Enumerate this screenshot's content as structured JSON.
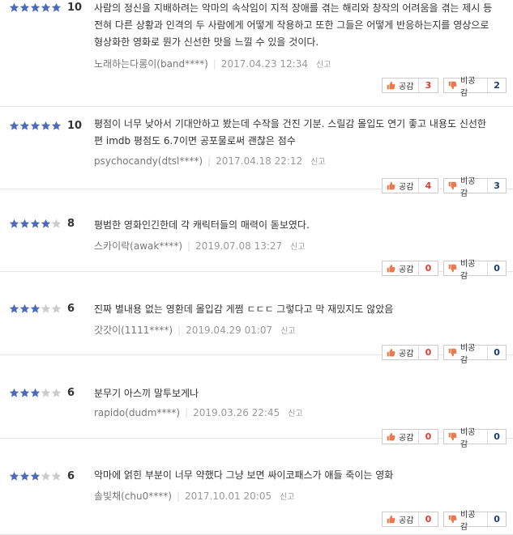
{
  "labels": {
    "like": "공감",
    "dislike": "비공감",
    "report": "신고"
  },
  "colors": {
    "star_on": "#4d6cb5",
    "star_off": "#cccccc",
    "like_count": "#e53a2b",
    "dislike_count": "#1f3b77"
  },
  "reviews": [
    {
      "stars": 5,
      "score": "10",
      "text": "사람의 정신을 지배하려는 악마의 속삭임이 지적 장애를 겪는 해리와 창작의 어려움을 겪는 제시 등 전혀 다른 상황과 인격의 두 사람에게 어떻게 작용하고 또한 그들은 어떻게 반응하는지를 영상으로 형상화한 영화로 뭔가 신선한 맛을 느낄 수 있을 것이다.",
      "author": "노래하는다롱이(band****)",
      "date": "2017.04.23 12:34",
      "likes": "3",
      "dislikes": "2"
    },
    {
      "stars": 5,
      "score": "10",
      "text": "평점이 너무 낮아서 기대안하고 봤는데 수작을 건진 기분. 스릴감 몰입도 연기 좋고 내용도 신선한 편 imdb 평점도 6.7이면 공포물로써 괜찮은 점수",
      "author": "psychocandy(dtsl****)",
      "date": "2017.04.18 22:12",
      "likes": "4",
      "dislikes": "3"
    },
    {
      "stars": 4,
      "score": "8",
      "text": "평범한 영화인긴한데 각 캐릭터들의 매력이 돋보였다.",
      "author": "스카이락(awak****)",
      "date": "2019.07.08 13:27",
      "likes": "0",
      "dislikes": "0"
    },
    {
      "stars": 3,
      "score": "6",
      "text": "진짜 별내용 없는 영환데 몰입감 게쩜 ㄷㄷㄷ 그렇다고 막 재밌지도 않았음",
      "author": "갓갓이(1111****)",
      "date": "2019.04.29 01:07",
      "likes": "0",
      "dislikes": "0"
    },
    {
      "stars": 3,
      "score": "6",
      "text": "분무기 아스끼 말투보게나",
      "author": "rapido(dudm****)",
      "date": "2019.03.26 22:45",
      "likes": "0",
      "dislikes": "0"
    },
    {
      "stars": 3,
      "score": "6",
      "text": "악마에 얽힌 부분이 너무 약했다 그냥 보면 싸이코패스가 애들 죽이는 영화",
      "author": "솔빛채(chu0****)",
      "date": "2017.10.01 20:05",
      "likes": "0",
      "dislikes": "0"
    }
  ]
}
